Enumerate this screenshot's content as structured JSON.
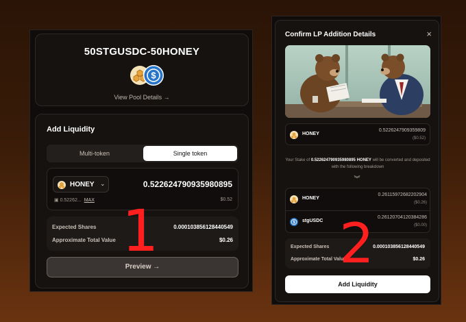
{
  "pool": {
    "name": "50STGUSDC-50HONEY",
    "view_details": "View Pool Details →"
  },
  "add_liquidity": {
    "title": "Add Liquidity",
    "tab_multi": "Multi-token",
    "tab_single": "Single token",
    "token_name": "HONEY",
    "amount": "0.522624790935980895",
    "balance": "0.52262...",
    "max_label": "MAX",
    "amount_usd": "$0.52",
    "expected_shares_label": "Expected Shares",
    "expected_shares_value": "0.000103856128440549",
    "total_value_label": "Approximate Total Value",
    "total_value": "$0.26",
    "preview_label": "Preview →"
  },
  "modal": {
    "title": "Confirm LP Addition Details",
    "input_token": "HONEY",
    "input_amount": "0.5226247909359809",
    "input_usd": "($0.52)",
    "note_prefix": "Your Stake of",
    "note_amount": "0.522624790935980895 HONEY",
    "note_suffix": "will be converted and deposited with the following breakdown",
    "breakdown": [
      {
        "token": "HONEY",
        "amount": "0.26115972682202904",
        "usd": "($0.26)"
      },
      {
        "token": "stgUSDC",
        "amount": "0.26120704120384286",
        "usd": "($0.00)"
      }
    ],
    "expected_shares_label": "Expected Shares",
    "expected_shares_value": "0.000103856128440549",
    "total_value_label": "Approximate Total Value",
    "total_value": "$0.26",
    "confirm_label": "Add Liquidity"
  },
  "annotations": {
    "step1": "1",
    "step2": "2"
  },
  "colors": {
    "accent_white": "#ffffff",
    "honey": "#e8a33a",
    "usdc_blue": "#2775ca",
    "annotation_red": "#ff1f1f"
  }
}
